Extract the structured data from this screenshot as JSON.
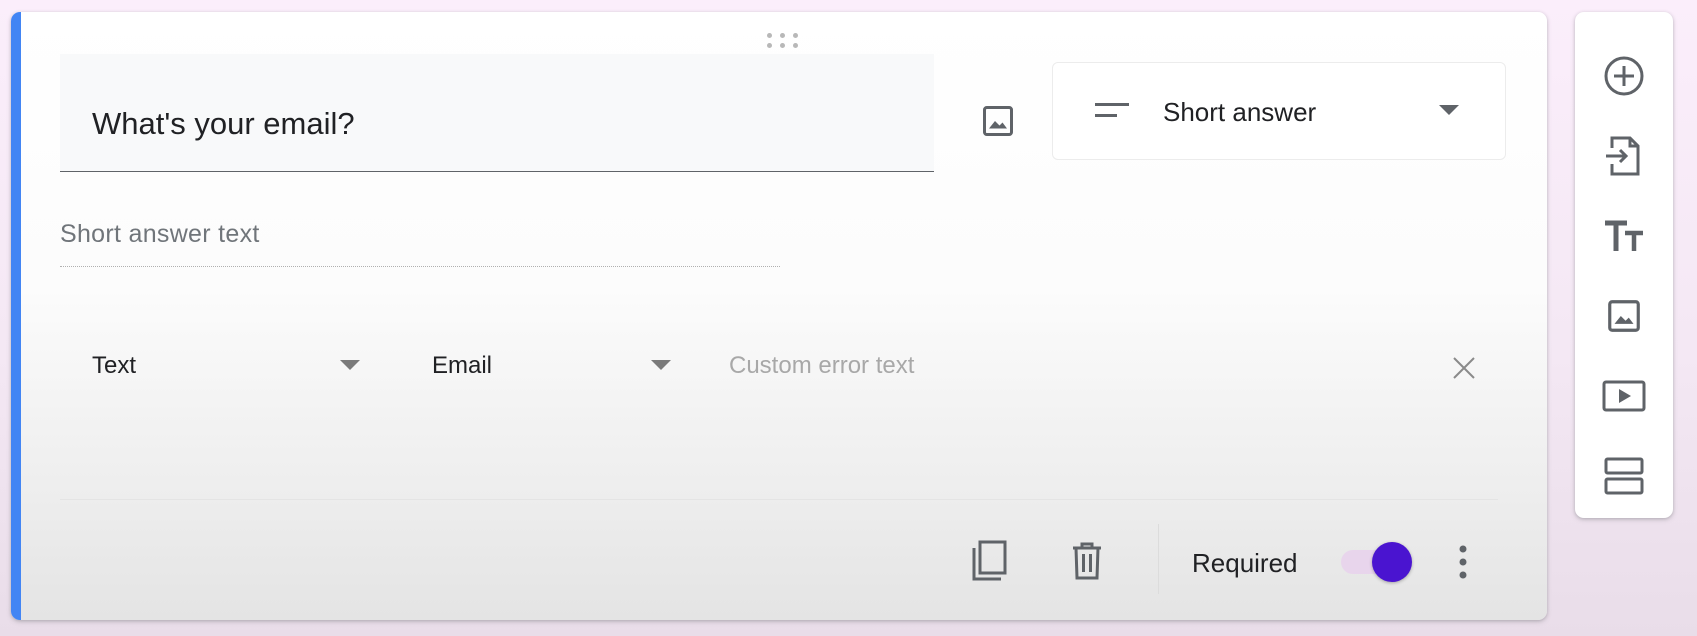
{
  "question": {
    "title": "What's your email?",
    "type_label": "Short answer",
    "answer_placeholder": "Short answer text"
  },
  "validation": {
    "type": "Text",
    "rule": "Email",
    "error_placeholder": "Custom error text",
    "error_value": ""
  },
  "footer": {
    "required_label": "Required",
    "required_on": true
  },
  "icons": {
    "drag": "drag-handle-icon",
    "image": "image-icon",
    "type": "short-answer-lines-icon",
    "dropdown": "caret-down-icon",
    "close": "close-icon",
    "duplicate": "copy-icon",
    "delete": "trash-icon",
    "more": "more-vert-icon"
  },
  "toolbar": [
    {
      "icon": "add-circle-icon"
    },
    {
      "icon": "import-icon"
    },
    {
      "icon": "title-text-icon"
    },
    {
      "icon": "image-icon"
    },
    {
      "icon": "video-icon"
    },
    {
      "icon": "section-icon"
    }
  ],
  "colors": {
    "accent": "#4285f4",
    "toggle_thumb": "#4a14d0",
    "toggle_track": "#e8d5ec"
  }
}
